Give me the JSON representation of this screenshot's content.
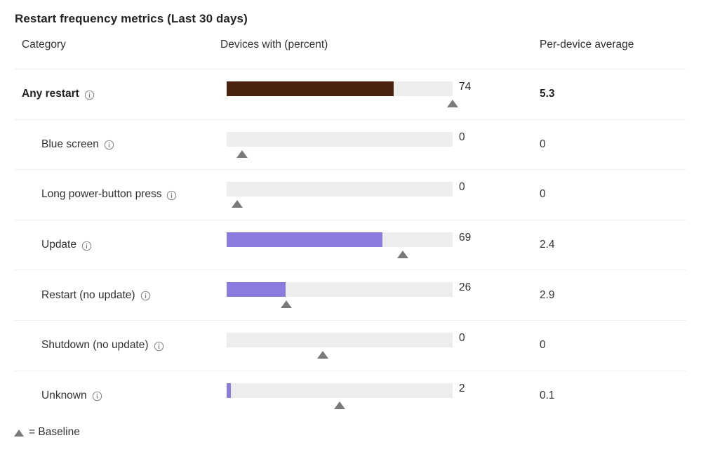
{
  "panel": {
    "title": "Restart frequency metrics (Last 30 days)"
  },
  "table": {
    "columns": {
      "category": "Category",
      "devices": "Devices with (percent)",
      "per_device": "Per-device average"
    },
    "rows": [
      {
        "category": "Any restart",
        "percent_label": "74",
        "per_device_label": "5.3",
        "percent": 74,
        "baseline_percent": 100,
        "bar_color": "#4b2110",
        "indented": false,
        "emphasis": true,
        "info_tooltip_icon": "info-icon"
      },
      {
        "category": "Blue screen",
        "percent_label": "0",
        "per_device_label": "0",
        "percent": 0,
        "baseline_percent": 6.8,
        "bar_color": "#8b7bde",
        "indented": true,
        "emphasis": false,
        "info_tooltip_icon": "info-icon"
      },
      {
        "category": "Long power-button press",
        "percent_label": "0",
        "per_device_label": "0",
        "percent": 0,
        "baseline_percent": 4.7,
        "bar_color": "#8b7bde",
        "indented": true,
        "emphasis": false,
        "info_tooltip_icon": "info-icon"
      },
      {
        "category": "Update",
        "percent_label": "69",
        "per_device_label": "2.4",
        "percent": 69,
        "baseline_percent": 78,
        "bar_color": "#8b7bde",
        "indented": true,
        "emphasis": false,
        "info_tooltip_icon": "info-icon"
      },
      {
        "category": "Restart (no update)",
        "percent_label": "26",
        "per_device_label": "2.9",
        "percent": 26,
        "baseline_percent": 26.5,
        "bar_color": "#8b7bde",
        "indented": true,
        "emphasis": false,
        "info_tooltip_icon": "info-icon"
      },
      {
        "category": "Shutdown (no update)",
        "percent_label": "0",
        "per_device_label": "0",
        "percent": 0,
        "baseline_percent": 42.5,
        "bar_color": "#8b7bde",
        "indented": true,
        "emphasis": false,
        "info_tooltip_icon": "info-icon"
      },
      {
        "category": "Unknown",
        "percent_label": "2",
        "per_device_label": "0.1",
        "percent": 2,
        "baseline_percent": 50,
        "bar_color": "#8b7bde",
        "indented": true,
        "emphasis": false,
        "info_tooltip_icon": "info-icon"
      }
    ]
  },
  "legend": {
    "marker_icon": "triangle-up-icon",
    "text": "= Baseline"
  },
  "chart_data": {
    "type": "bar",
    "title": "Restart frequency metrics (Last 30 days)",
    "xlabel": "Devices with (percent)",
    "ylabel": "Category",
    "xlim": [
      0,
      100
    ],
    "grid": false,
    "legend": "▲ = Baseline",
    "categories": [
      "Any restart",
      "Blue screen",
      "Long power-button press",
      "Update",
      "Restart (no update)",
      "Shutdown (no update)",
      "Unknown"
    ],
    "series": [
      {
        "name": "Devices with (percent)",
        "values": [
          74,
          0,
          0,
          69,
          26,
          0,
          2
        ]
      },
      {
        "name": "Baseline (percent)",
        "values": [
          100,
          6.8,
          4.7,
          78,
          26.5,
          42.5,
          50
        ]
      },
      {
        "name": "Per-device average",
        "values": [
          5.3,
          0,
          0,
          2.4,
          2.9,
          0,
          0.1
        ]
      }
    ],
    "colors": {
      "any_restart_bar": "#4b2110",
      "sub_bar": "#8b7bde",
      "track": "#ededed",
      "baseline_marker": "#7a7a7a"
    }
  }
}
